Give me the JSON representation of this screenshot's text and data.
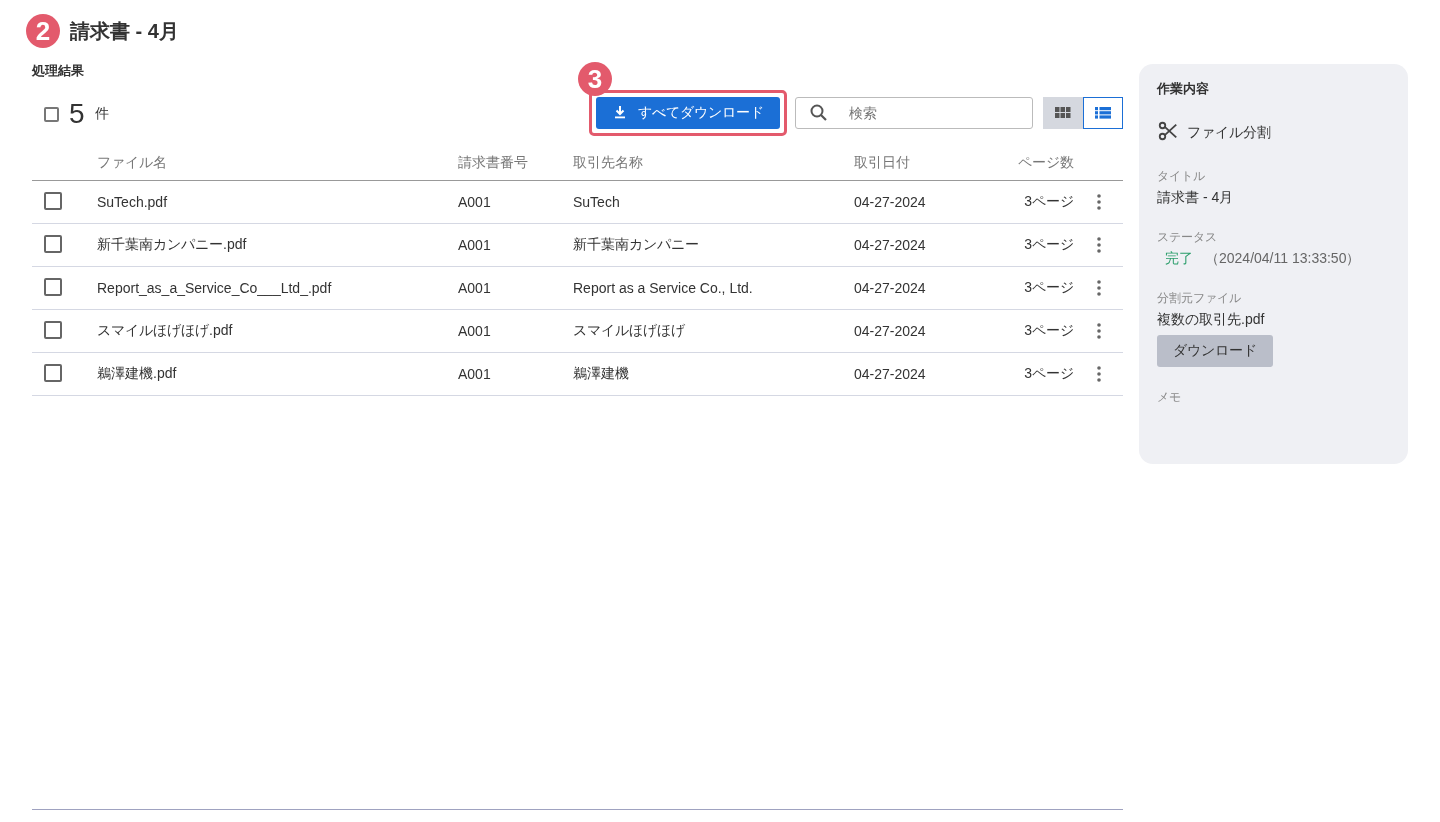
{
  "header": {
    "step_badge": "2",
    "title": "請求書 - 4月"
  },
  "results": {
    "heading": "処理結果",
    "select_all": {
      "checked": false
    },
    "count": "5",
    "count_unit": "件",
    "download_all": {
      "badge": "3",
      "label": "すべてダウンロード",
      "highlighted": true
    },
    "search": {
      "placeholder": "検索"
    },
    "view_toggle": [
      {
        "kind": "grid",
        "selected": false
      },
      {
        "kind": "list",
        "selected": true
      }
    ],
    "table": {
      "columns": [
        "ファイル名",
        "請求書番号",
        "取引先名称",
        "取引日付",
        "ページ数"
      ],
      "rows": [
        {
          "checked": false,
          "cells": [
            "SuTech.pdf",
            "A001",
            "SuTech",
            "04-27-2024",
            "3ページ"
          ]
        },
        {
          "checked": false,
          "cells": [
            "新千葉南カンパニー.pdf",
            "A001",
            "新千葉南カンパニー",
            "04-27-2024",
            "3ページ"
          ]
        },
        {
          "checked": false,
          "cells": [
            "Report_as_a_Service_Co___Ltd_.pdf",
            "A001",
            "Report as a Service Co., Ltd.",
            "04-27-2024",
            "3ページ"
          ]
        },
        {
          "checked": false,
          "cells": [
            "スマイルほげほげ.pdf",
            "A001",
            "スマイルほげほげ",
            "04-27-2024",
            "3ページ"
          ]
        },
        {
          "checked": false,
          "cells": [
            "鵜澤建機.pdf",
            "A001",
            "鵜澤建機",
            "04-27-2024",
            "3ページ"
          ]
        }
      ]
    }
  },
  "side_panel": {
    "heading": "作業内容",
    "task": "ファイル分割",
    "fields": [
      {
        "kind": "text",
        "label": "タイトル",
        "value": "請求書 - 4月"
      },
      {
        "kind": "status",
        "label": "ステータス",
        "value": "完了",
        "detail": "（2024/04/11 13:33:50）"
      },
      {
        "kind": "file",
        "label": "分割元ファイル",
        "value": "複数の取引先.pdf",
        "button": "ダウンロード"
      },
      {
        "kind": "text",
        "label": "メモ"
      }
    ]
  }
}
